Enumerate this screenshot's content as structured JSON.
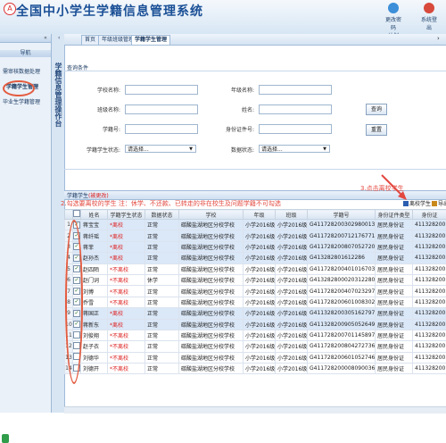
{
  "header": {
    "app_title": "全国中小学生学籍信息管理系统",
    "marker": "A",
    "buttons": [
      {
        "label": "更改密码",
        "sub": "计划",
        "color": "#3c8fd8"
      },
      {
        "label": "系统登出",
        "sub": "",
        "color": "#d84a3c"
      }
    ]
  },
  "sidebar": {
    "header": "导航",
    "collapse": "«",
    "section": "导航",
    "items": [
      {
        "label": "需审核数据处理"
      },
      {
        "label": "学籍学生管理"
      },
      {
        "label": "毕业生学籍管理"
      }
    ],
    "vertical_title": "学籍信息管理操作台"
  },
  "tabs": [
    {
      "label": "首页"
    },
    {
      "label": "年级班级管理"
    },
    {
      "label": "学籍学生管理"
    }
  ],
  "query": {
    "title": "查询条件",
    "fields": [
      {
        "label": "学校名称:"
      },
      {
        "label": "年级名称:"
      },
      {
        "label": "班级名称:"
      },
      {
        "label": "姓名:"
      },
      {
        "label": "学籍号:"
      },
      {
        "label": "身份证件号:"
      },
      {
        "label": "学籍学生状态:",
        "value": "请选择..."
      },
      {
        "label": "数据状态:",
        "value": "请选择..."
      }
    ],
    "search_button": "查询",
    "reset_button": "重置"
  },
  "grid": {
    "title": "学籍学生",
    "title_paren": "(被更改)",
    "annotation_2": "2.勾选要离校的学生   注：休学、不还款、已转走的非在校生及问题学籍不可勾选",
    "annotation_3": "3.点击离校学生",
    "toolbar": [
      {
        "label": "离校学生",
        "color": "#2a5db0"
      },
      {
        "label": "导出",
        "color": "#c98a1b"
      }
    ],
    "columns": [
      "",
      "",
      "姓名",
      "学籍学生状态",
      "数据状态",
      "学校",
      "年级",
      "班级",
      "学籍号",
      "身份证件类型",
      "身份证"
    ],
    "rows": [
      {
        "n": "1",
        "checked": true,
        "sel": true,
        "name": "蒋宝宝",
        "status": "*离校",
        "data": "正常",
        "school": "碳酸盐湖地区分校学校",
        "grade": "小学2016级",
        "cls": "小学2016级1班",
        "id": "G411728200302980013",
        "idtype": "居民身份证",
        "idno": "411328200"
      },
      {
        "n": "2",
        "checked": true,
        "sel": true,
        "name": "蒋纤瑶",
        "status": "*离校",
        "data": "正常",
        "school": "碳酸盐湖地区分校学校",
        "grade": "小学2016级",
        "cls": "小学2016级1班",
        "id": "G411728200712176771",
        "idtype": "居民身份证",
        "idno": "411328200"
      },
      {
        "n": "3",
        "checked": true,
        "sel": true,
        "name": "蒋菲",
        "status": "*离校",
        "data": "正常",
        "school": "碳酸盐湖地区分校学校",
        "grade": "小学2016级",
        "cls": "小学2016级1班",
        "id": "G411728200807052720",
        "idtype": "居民身份证",
        "idno": "411328200"
      },
      {
        "n": "4",
        "checked": true,
        "sel": true,
        "name": "赵孙杰",
        "status": "*离校",
        "data": "正常",
        "school": "碳酸盐湖地区分校学校",
        "grade": "小学2016级",
        "cls": "小学2016级1班",
        "id": "G413282801612286",
        "idtype": "居民身份证",
        "idno": "411328200"
      },
      {
        "n": "5",
        "checked": true,
        "sel": false,
        "name": "赵四陌",
        "status": "*不离校",
        "data": "正常",
        "school": "碳酸盐湖地区分校学校",
        "grade": "小学2016级",
        "cls": "小学2016级1班",
        "id": "G411728200401016703",
        "idtype": "居民身份证",
        "idno": "411328200"
      },
      {
        "n": "6",
        "checked": true,
        "sel": false,
        "name": "赵门词",
        "status": "*不离校",
        "data": "休学",
        "school": "碳酸盐湖地区分校学校",
        "grade": "小学2016级",
        "cls": "小学2016级1班",
        "id": "G413282800020312280",
        "idtype": "居民身份证",
        "idno": "411328200"
      },
      {
        "n": "7",
        "checked": true,
        "sel": false,
        "name": "刘博",
        "status": "*不离校",
        "data": "正常",
        "school": "碳酸盐湖地区分校学校",
        "grade": "小学2016级",
        "cls": "小学2016级1班",
        "id": "G411728200407023297",
        "idtype": "居民身份证",
        "idno": "411328200"
      },
      {
        "n": "8",
        "checked": true,
        "sel": false,
        "name": "乔雪",
        "status": "*不离校",
        "data": "正常",
        "school": "碳酸盐湖地区分校学校",
        "grade": "小学2016级",
        "cls": "小学2016级1班",
        "id": "G411728200601008302",
        "idtype": "居民身份证",
        "idno": "411328200"
      },
      {
        "n": "9",
        "checked": true,
        "sel": true,
        "name": "蒋国正",
        "status": "*离校",
        "data": "正常",
        "school": "碳酸盐湖地区分校学校",
        "grade": "小学2016级",
        "cls": "小学2016级1班",
        "id": "G411328200305162797",
        "idtype": "居民身份证",
        "idno": "411328200"
      },
      {
        "n": "10",
        "checked": true,
        "sel": true,
        "name": "蒋新东",
        "status": "*离校",
        "data": "正常",
        "school": "碳酸盐湖地区分校学校",
        "grade": "小学2016级",
        "cls": "小学2016级1班",
        "id": "G411328200905052649",
        "idtype": "居民身份证",
        "idno": "411328200"
      },
      {
        "n": "11",
        "checked": false,
        "sel": false,
        "name": "刘俊翔",
        "status": "*不离校",
        "data": "正常",
        "school": "碳酸盐湖地区分校学校",
        "grade": "小学2016级",
        "cls": "小学2016级1班",
        "id": "G411728200701145897",
        "idtype": "居民身份证",
        "idno": "411328200"
      },
      {
        "n": "12",
        "checked": false,
        "sel": false,
        "name": "赵子衣",
        "status": "*不离校",
        "data": "正常",
        "school": "碳酸盐湖地区分校学校",
        "grade": "小学2016级",
        "cls": "小学2016级1班",
        "id": "G411728200804272736",
        "idtype": "居民身份证",
        "idno": "411328200"
      },
      {
        "n": "13",
        "checked": false,
        "sel": false,
        "name": "刘德华",
        "status": "*不离校",
        "data": "正常",
        "school": "碳酸盐湖地区分校学校",
        "grade": "小学2016级",
        "cls": "小学2016级1班",
        "id": "G411728200601052746",
        "idtype": "居民身份证",
        "idno": "411328200"
      },
      {
        "n": "14",
        "checked": false,
        "sel": false,
        "name": "刘德开",
        "status": "*不离校",
        "data": "正常",
        "school": "碳酸盐湖地区分校学校",
        "grade": "小学2016级",
        "cls": "小学2016级1班",
        "id": "G411728200008090036",
        "idtype": "居民身份证",
        "idno": "411328200"
      }
    ]
  }
}
